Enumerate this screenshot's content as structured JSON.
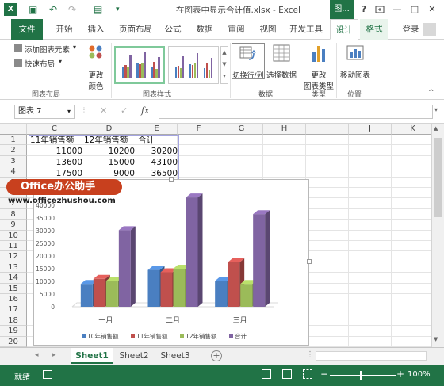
{
  "app": {
    "logo": "X",
    "title": "在图表中显示合计值.xlsx - Excel",
    "context_title": "图...",
    "login": "登录"
  },
  "window": {
    "help": "?",
    "restore_icon": "restore-icon",
    "minimize": "—",
    "maximize": "□",
    "close": "✕"
  },
  "tabs": {
    "file": "文件",
    "home": "开始",
    "insert": "插入",
    "layout": "页面布局",
    "formula": "公式",
    "data": "数据",
    "review": "审阅",
    "view": "视图",
    "developer": "开发工具",
    "design": "设计",
    "format": "格式"
  },
  "ribbon": {
    "add_element": "添加图表元素",
    "quick_layout": "快速布局",
    "change_color_1": "更改",
    "change_color_2": "颜色",
    "group_layout": "图表布局",
    "group_styles": "图表样式",
    "switch_rowcol": "切换行/列",
    "select_data": "选择数据",
    "group_data": "数据",
    "change_type_1": "更改",
    "change_type_2": "图表类型",
    "group_type": "类型",
    "move_chart": "移动图表",
    "group_location": "位置"
  },
  "formula_bar": {
    "name_box": "图表 7",
    "cancel": "✕",
    "enter": "✓",
    "fx": "fx",
    "value": ""
  },
  "columns": [
    "C",
    "D",
    "E",
    "F",
    "G",
    "H",
    "I",
    "J",
    "K"
  ],
  "rows": [
    "1",
    "2",
    "3",
    "4",
    "5",
    "6",
    "7",
    "8",
    "9",
    "10",
    "11",
    "12",
    "13",
    "14",
    "15",
    "16",
    "17",
    "18",
    "19",
    "20"
  ],
  "table": {
    "headers": [
      "11年销售额",
      "12年销售额",
      "合计"
    ],
    "rows": [
      [
        "11000",
        "10200",
        "30200"
      ],
      [
        "13600",
        "15000",
        "43100"
      ],
      [
        "17500",
        "9000",
        "36500"
      ]
    ]
  },
  "chart_data": {
    "type": "bar",
    "categories": [
      "一月",
      "二月",
      "三月"
    ],
    "series": [
      {
        "name": "10年销售额",
        "values": [
          9000,
          14500,
          10200
        ]
      },
      {
        "name": "11年销售额",
        "values": [
          11000,
          13600,
          17500
        ]
      },
      {
        "name": "12年销售额",
        "values": [
          10200,
          15000,
          9000
        ]
      },
      {
        "name": "合计",
        "values": [
          30200,
          43100,
          36500
        ]
      }
    ],
    "colors": [
      "#4a7fc1",
      "#c0504d",
      "#9bbb59",
      "#8064a2"
    ],
    "ylim": [
      0,
      45000
    ],
    "yticks": [
      "0",
      "5000",
      "10000",
      "15000",
      "20000",
      "25000",
      "30000",
      "35000",
      "40000",
      "45000"
    ],
    "legend": "bottom",
    "grid": false
  },
  "watermark": {
    "brand": "Office办公助手",
    "url": "www.officezhushou.com"
  },
  "sheets": [
    "Sheet1",
    "Sheet2",
    "Sheet3"
  ],
  "status": {
    "ready": "就绪",
    "zoom": "100%",
    "minus": "−",
    "plus": "+"
  }
}
